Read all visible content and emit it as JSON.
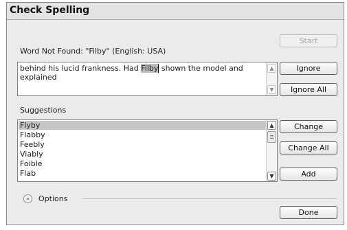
{
  "dialog": {
    "title": "Check Spelling",
    "word_not_found_label": "Word Not Found: \"Filby\" (English: USA)",
    "context": {
      "before": "behind his lucid frankness. Had ",
      "highlight": "Filby",
      "after": " shown the model and explained"
    },
    "suggestions_label": "Suggestions",
    "suggestions": [
      "Flyby",
      "Flabby",
      "Feebly",
      "Viably",
      "Foible",
      "Flab"
    ],
    "selected_suggestion": "Flyby",
    "options_label": "Options",
    "buttons": {
      "start": "Start",
      "ignore": "Ignore",
      "ignore_all": "Ignore All",
      "change": "Change",
      "change_all": "Change All",
      "add": "Add",
      "done": "Done"
    },
    "icons": {
      "scroll_up": "▲",
      "scroll_down": "▼",
      "options_toggle": "»"
    }
  }
}
